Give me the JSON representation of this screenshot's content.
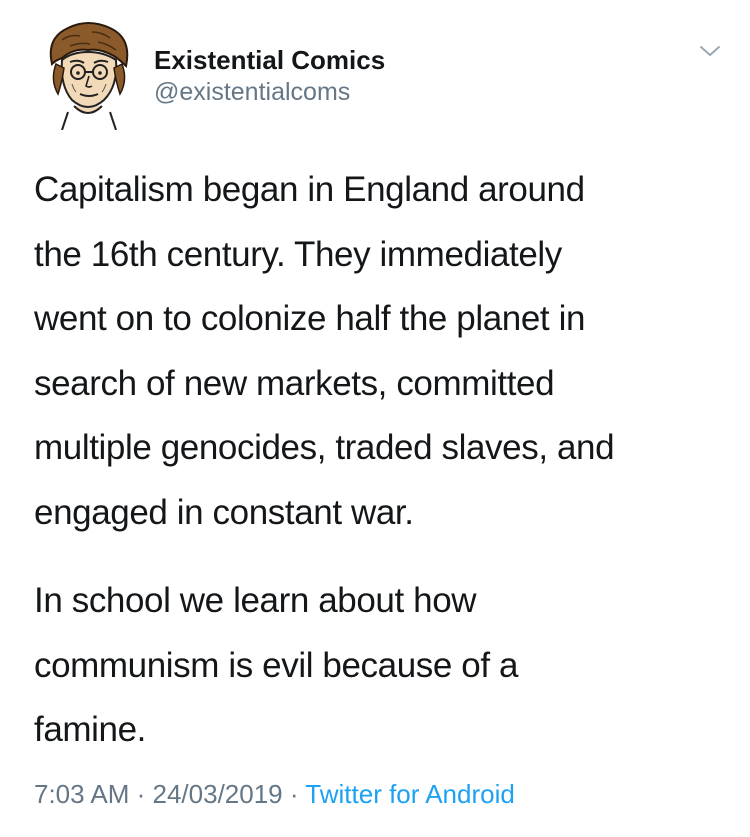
{
  "author": {
    "display_name": "Existential Comics",
    "handle": "@existentialcoms",
    "avatar_icon": "cartoon-portrait-avatar"
  },
  "menu": {
    "icon": "chevron-down-icon"
  },
  "tweet": {
    "paragraphs": [
      "Capitalism began in England around\nthe 16th century. They immediately\nwent on to colonize half the planet in\nsearch of new markets, committed\nmultiple genocides, traded slaves, and\nengaged in constant war.",
      "In school we learn about how\ncommunism is evil because of a\nfamine."
    ]
  },
  "meta": {
    "time": "7:03 AM",
    "separator": " · ",
    "date": "24/03/2019",
    "source": "Twitter for Android"
  },
  "colors": {
    "text": "#14171a",
    "secondary": "#657786",
    "link": "#1da1f2"
  }
}
